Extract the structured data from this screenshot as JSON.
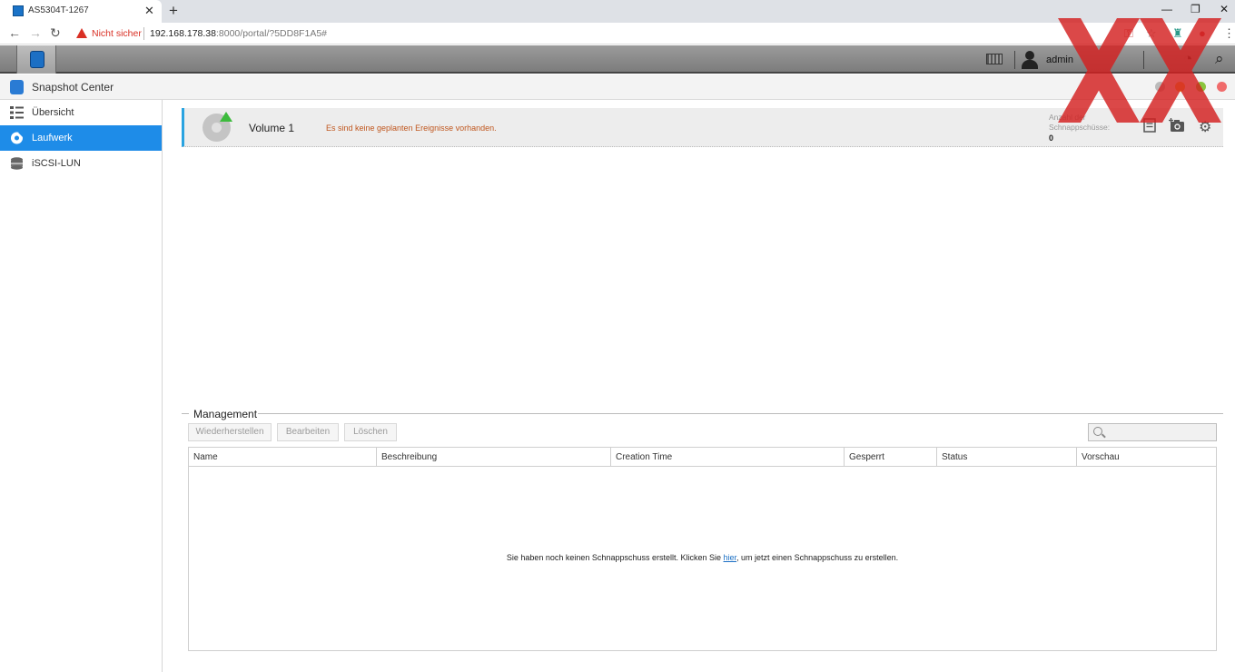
{
  "browser": {
    "tab_title": "AS5304T-1267",
    "tab_close": "✕",
    "new_tab": "+",
    "security_label": "Nicht sicher",
    "url_host": "192.168.178.38",
    "url_rest": ":8000/portal/?5DD8F1A5#",
    "window_controls": {
      "minimize": "—",
      "restore": "❐",
      "close": "✕"
    },
    "nav": {
      "back": "←",
      "forward": "→",
      "reload": "↻"
    },
    "menu": "⋮"
  },
  "topbar": {
    "user": "admin"
  },
  "app": {
    "title": "Snapshot Center",
    "colors": {
      "accent": "#1e8ce8",
      "dot_red": "#f06b6b",
      "dot_yellow": "#f2b134",
      "dot_green": "#8ac53e"
    }
  },
  "sidebar": {
    "items": [
      {
        "label": "Übersicht",
        "icon": "list-icon",
        "active": false
      },
      {
        "label": "Laufwerk",
        "icon": "volume-icon",
        "active": true
      },
      {
        "label": "iSCSI-LUN",
        "icon": "database-icon",
        "active": false
      }
    ]
  },
  "volume": {
    "name": "Volume 1",
    "message": "Es sind keine geplanten Ereignisse vorhanden.",
    "count_label": "Anzahl der Schnappschüsse:",
    "count": "0"
  },
  "management": {
    "title": "Management",
    "buttons": {
      "restore": "Wiederherstellen",
      "edit": "Bearbeiten",
      "delete": "Löschen"
    },
    "columns": [
      "Name",
      "Beschreibung",
      "Creation Time",
      "Gesperrt",
      "Status",
      "Vorschau"
    ],
    "empty_before": "Sie haben noch keinen Schnappschuss erstellt. Klicken Sie ",
    "empty_link": "hier",
    "empty_after": ", um jetzt einen Schnappschuss zu erstellen."
  }
}
